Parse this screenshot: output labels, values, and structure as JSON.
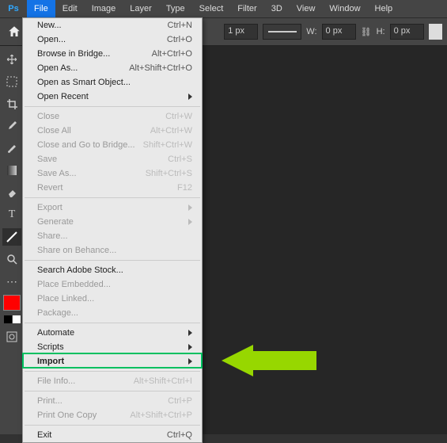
{
  "logo": "Ps",
  "menubar": [
    "File",
    "Edit",
    "Image",
    "Layer",
    "Type",
    "Select",
    "Filter",
    "3D",
    "View",
    "Window",
    "Help"
  ],
  "active_menu_index": 0,
  "optbar": {
    "px_value": "1 px",
    "w_label": "W:",
    "w_value": "0 px",
    "h_label": "H:",
    "h_value": "0 px",
    "link_glyph": "⛓"
  },
  "dropdown": [
    {
      "t": "item",
      "label": "New...",
      "sc": "Ctrl+N"
    },
    {
      "t": "item",
      "label": "Open...",
      "sc": "Ctrl+O"
    },
    {
      "t": "item",
      "label": "Browse in Bridge...",
      "sc": "Alt+Ctrl+O"
    },
    {
      "t": "item",
      "label": "Open As...",
      "sc": "Alt+Shift+Ctrl+O"
    },
    {
      "t": "item",
      "label": "Open as Smart Object..."
    },
    {
      "t": "item",
      "label": "Open Recent",
      "sub": true
    },
    {
      "t": "sep"
    },
    {
      "t": "item",
      "label": "Close",
      "sc": "Ctrl+W",
      "disabled": true
    },
    {
      "t": "item",
      "label": "Close All",
      "sc": "Alt+Ctrl+W",
      "disabled": true
    },
    {
      "t": "item",
      "label": "Close and Go to Bridge...",
      "sc": "Shift+Ctrl+W",
      "disabled": true
    },
    {
      "t": "item",
      "label": "Save",
      "sc": "Ctrl+S",
      "disabled": true
    },
    {
      "t": "item",
      "label": "Save As...",
      "sc": "Shift+Ctrl+S",
      "disabled": true
    },
    {
      "t": "item",
      "label": "Revert",
      "sc": "F12",
      "disabled": true
    },
    {
      "t": "sep"
    },
    {
      "t": "item",
      "label": "Export",
      "sub": true,
      "disabled": true
    },
    {
      "t": "item",
      "label": "Generate",
      "sub": true,
      "disabled": true
    },
    {
      "t": "item",
      "label": "Share...",
      "disabled": true
    },
    {
      "t": "item",
      "label": "Share on Behance...",
      "disabled": true
    },
    {
      "t": "sep"
    },
    {
      "t": "item",
      "label": "Search Adobe Stock..."
    },
    {
      "t": "item",
      "label": "Place Embedded...",
      "disabled": true
    },
    {
      "t": "item",
      "label": "Place Linked...",
      "disabled": true
    },
    {
      "t": "item",
      "label": "Package...",
      "disabled": true
    },
    {
      "t": "sep"
    },
    {
      "t": "item",
      "label": "Automate",
      "sub": true
    },
    {
      "t": "item",
      "label": "Scripts",
      "sub": true
    },
    {
      "t": "item",
      "label": "Import",
      "sub": true,
      "hl": true
    },
    {
      "t": "sep"
    },
    {
      "t": "item",
      "label": "File Info...",
      "sc": "Alt+Shift+Ctrl+I",
      "disabled": true
    },
    {
      "t": "sep"
    },
    {
      "t": "item",
      "label": "Print...",
      "sc": "Ctrl+P",
      "disabled": true
    },
    {
      "t": "item",
      "label": "Print One Copy",
      "sc": "Alt+Shift+Ctrl+P",
      "disabled": true
    },
    {
      "t": "sep"
    },
    {
      "t": "item",
      "label": "Exit",
      "sc": "Ctrl+Q"
    }
  ]
}
